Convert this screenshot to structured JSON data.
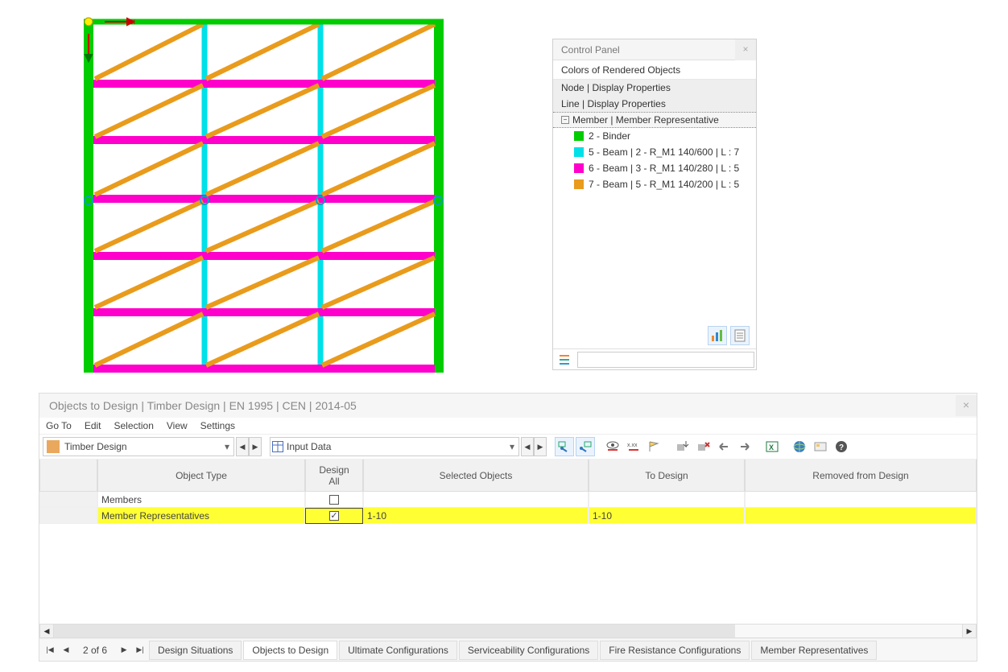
{
  "control_panel": {
    "title": "Control Panel",
    "subtitle": "Colors of Rendered Objects",
    "rows": {
      "node": "Node | Display Properties",
      "line": "Line | Display Properties",
      "member": "Member | Member Representative"
    },
    "items": [
      {
        "label": "2 - Binder",
        "color": "#00cc00"
      },
      {
        "label": "5 - Beam | 2 - R_M1 140/600 | L : 7",
        "color": "#00e0e8"
      },
      {
        "label": "6 - Beam | 3 - R_M1 140/280 | L : 5",
        "color": "#ff00cc"
      },
      {
        "label": "7 - Beam | 5 - R_M1 140/200 | L : 5",
        "color": "#e99b1c"
      }
    ]
  },
  "design_window": {
    "title": "Objects to Design | Timber Design | EN 1995 | CEN | 2014-05",
    "menu": [
      "Go To",
      "Edit",
      "Selection",
      "View",
      "Settings"
    ],
    "selects": {
      "left": "Timber Design",
      "right": "Input Data"
    },
    "headers": {
      "object": "Object Type",
      "design1": "Design",
      "design2": "All",
      "selected": "Selected Objects",
      "todesign": "To Design",
      "removed": "Removed from Design"
    },
    "rows": [
      {
        "name": "Members",
        "checked": false,
        "selected": "",
        "to_design": "",
        "highlight": false
      },
      {
        "name": "Member Representatives",
        "checked": true,
        "selected": "1-10",
        "to_design": "1-10",
        "highlight": true
      }
    ],
    "pager": "2 of 6",
    "tabs": [
      "Design Situations",
      "Objects to Design",
      "Ultimate Configurations",
      "Serviceability Configurations",
      "Fire Resistance Configurations",
      "Member Representatives"
    ],
    "active_tab": 1
  },
  "colors": {
    "green": "#00cc00",
    "cyan": "#00e0e8",
    "magenta": "#ff00cc",
    "orange": "#e99b1c"
  }
}
